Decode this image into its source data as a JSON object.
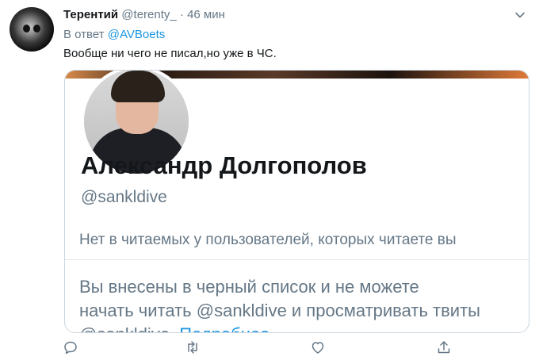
{
  "tweet": {
    "author_name": "Терентий",
    "author_handle": "@terenty_",
    "separator": "·",
    "time": "46 мин",
    "reply_prefix": "В ответ",
    "reply_mention": "@AVBoets",
    "text": "Вообще ни чего не писал,но уже в ЧС."
  },
  "card": {
    "full_name": "Александр Долгополов",
    "screen_name": "@sankldive",
    "follow_context": "Нет в читаемых у пользователей, которых читаете вы",
    "blocked_line1": "Вы внесены в черный список и не можете",
    "blocked_line2": "начать читать @sankldive и просматривать твиты",
    "blocked_line3_handle": "@sankldive.",
    "blocked_line3_link": "Подробнее"
  },
  "icons": {
    "reply": "reply-icon",
    "retweet": "retweet-icon",
    "like": "heart-icon",
    "share": "share-icon",
    "caret": "chevron-down-icon"
  },
  "colors": {
    "link": "#1b95e0",
    "secondary_text": "#657786",
    "primary_text": "#14171a",
    "border": "#ccd6dd"
  }
}
